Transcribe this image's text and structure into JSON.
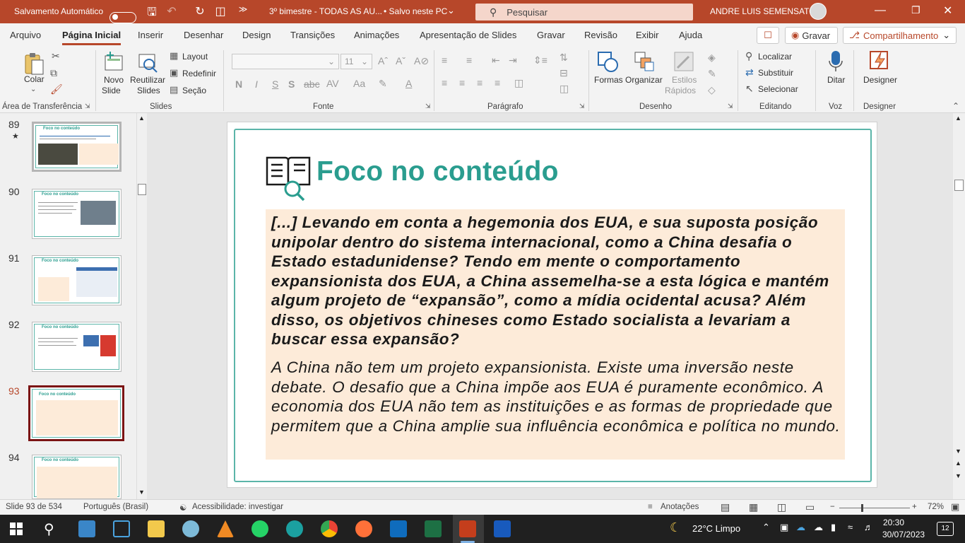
{
  "titlebar": {
    "autosave_label": "Salvamento Automático",
    "autosave_state": "off",
    "doc_title": "3º bimestre - TODAS AS AU...",
    "save_status": "• Salvo neste PC",
    "search_placeholder": "Pesquisar",
    "user_name": "ANDRE LUIS SEMENSATO",
    "accent_color": "#b7472a"
  },
  "menu": {
    "tabs": [
      "Arquivo",
      "Página Inicial",
      "Inserir",
      "Desenhar",
      "Design",
      "Transições",
      "Animações",
      "Apresentação de Slides",
      "Gravar",
      "Revisão",
      "Exibir",
      "Ajuda"
    ],
    "active_tab": "Página Inicial",
    "record_button": "Gravar",
    "share_button": "Compartilhamento"
  },
  "ribbon": {
    "clipboard": {
      "paste": "Colar",
      "group": "Área de Transferência"
    },
    "slides": {
      "new_slide_1": "Novo",
      "new_slide_2": "Slide",
      "reuse_1": "Reutilizar",
      "reuse_2": "Slides",
      "layout": "Layout",
      "reset": "Redefinir",
      "section": "Seção",
      "group": "Slides"
    },
    "font": {
      "font_size": "11",
      "bold": "N",
      "italic": "I",
      "underline": "S",
      "strike": "S",
      "group": "Fonte"
    },
    "paragraph": {
      "group": "Parágrafo"
    },
    "drawing": {
      "shapes": "Formas",
      "arrange": "Organizar",
      "quick_styles_1": "Estilos",
      "quick_styles_2": "Rápidos",
      "group": "Desenho"
    },
    "editing": {
      "find": "Localizar",
      "replace": "Substituir",
      "select": "Selecionar",
      "group": "Editando"
    },
    "voice": {
      "dictate": "Ditar",
      "group": "Voz"
    },
    "designer": {
      "label": "Designer",
      "group": "Designer"
    }
  },
  "thumbnails": [
    {
      "number": "89",
      "title": "Foco no conteúdo",
      "starred": true
    },
    {
      "number": "90",
      "title": "Foco no conteúdo"
    },
    {
      "number": "91",
      "title": "Foco no conteúdo"
    },
    {
      "number": "92",
      "title": "Foco no conteúdo"
    },
    {
      "number": "93",
      "title": "Foco no conteúdo",
      "selected": true
    },
    {
      "number": "94",
      "title": "Foco no conteúdo"
    }
  ],
  "slide": {
    "title": "Foco no conteúdo",
    "question": "[...] Levando em conta a hegemonia dos EUA, e sua suposta posição unipolar dentro do sistema internacional, como a China desafia o Estado estadunidense? Tendo em mente o comportamento expansionista dos EUA, a China assemelha-se a esta lógica e mantém algum projeto de “expansão”, como a mídia ocidental acusa? Além disso, os objetivos chineses como Estado socialista a levariam a buscar essa expansão?",
    "answer": "A China não tem um projeto expansionista. Existe uma inversão neste debate. O desafio que a China impõe aos EUA é puramente econômico. A economia dos EUA não tem as instituições e as formas de propriedade que permitem que a China amplie sua influência econômica e política no mundo.",
    "title_color": "#2a9d8f",
    "box_color": "#fdebd9"
  },
  "statusbar": {
    "slide_info": "Slide 93 de 534",
    "language": "Português (Brasil)",
    "accessibility": "Acessibilidade: investigar",
    "notes": "Anotações",
    "zoom": "72%"
  },
  "taskbar": {
    "weather": "22°C  Limpo",
    "time": "20:30",
    "date": "30/07/2023",
    "notifications": "12"
  }
}
